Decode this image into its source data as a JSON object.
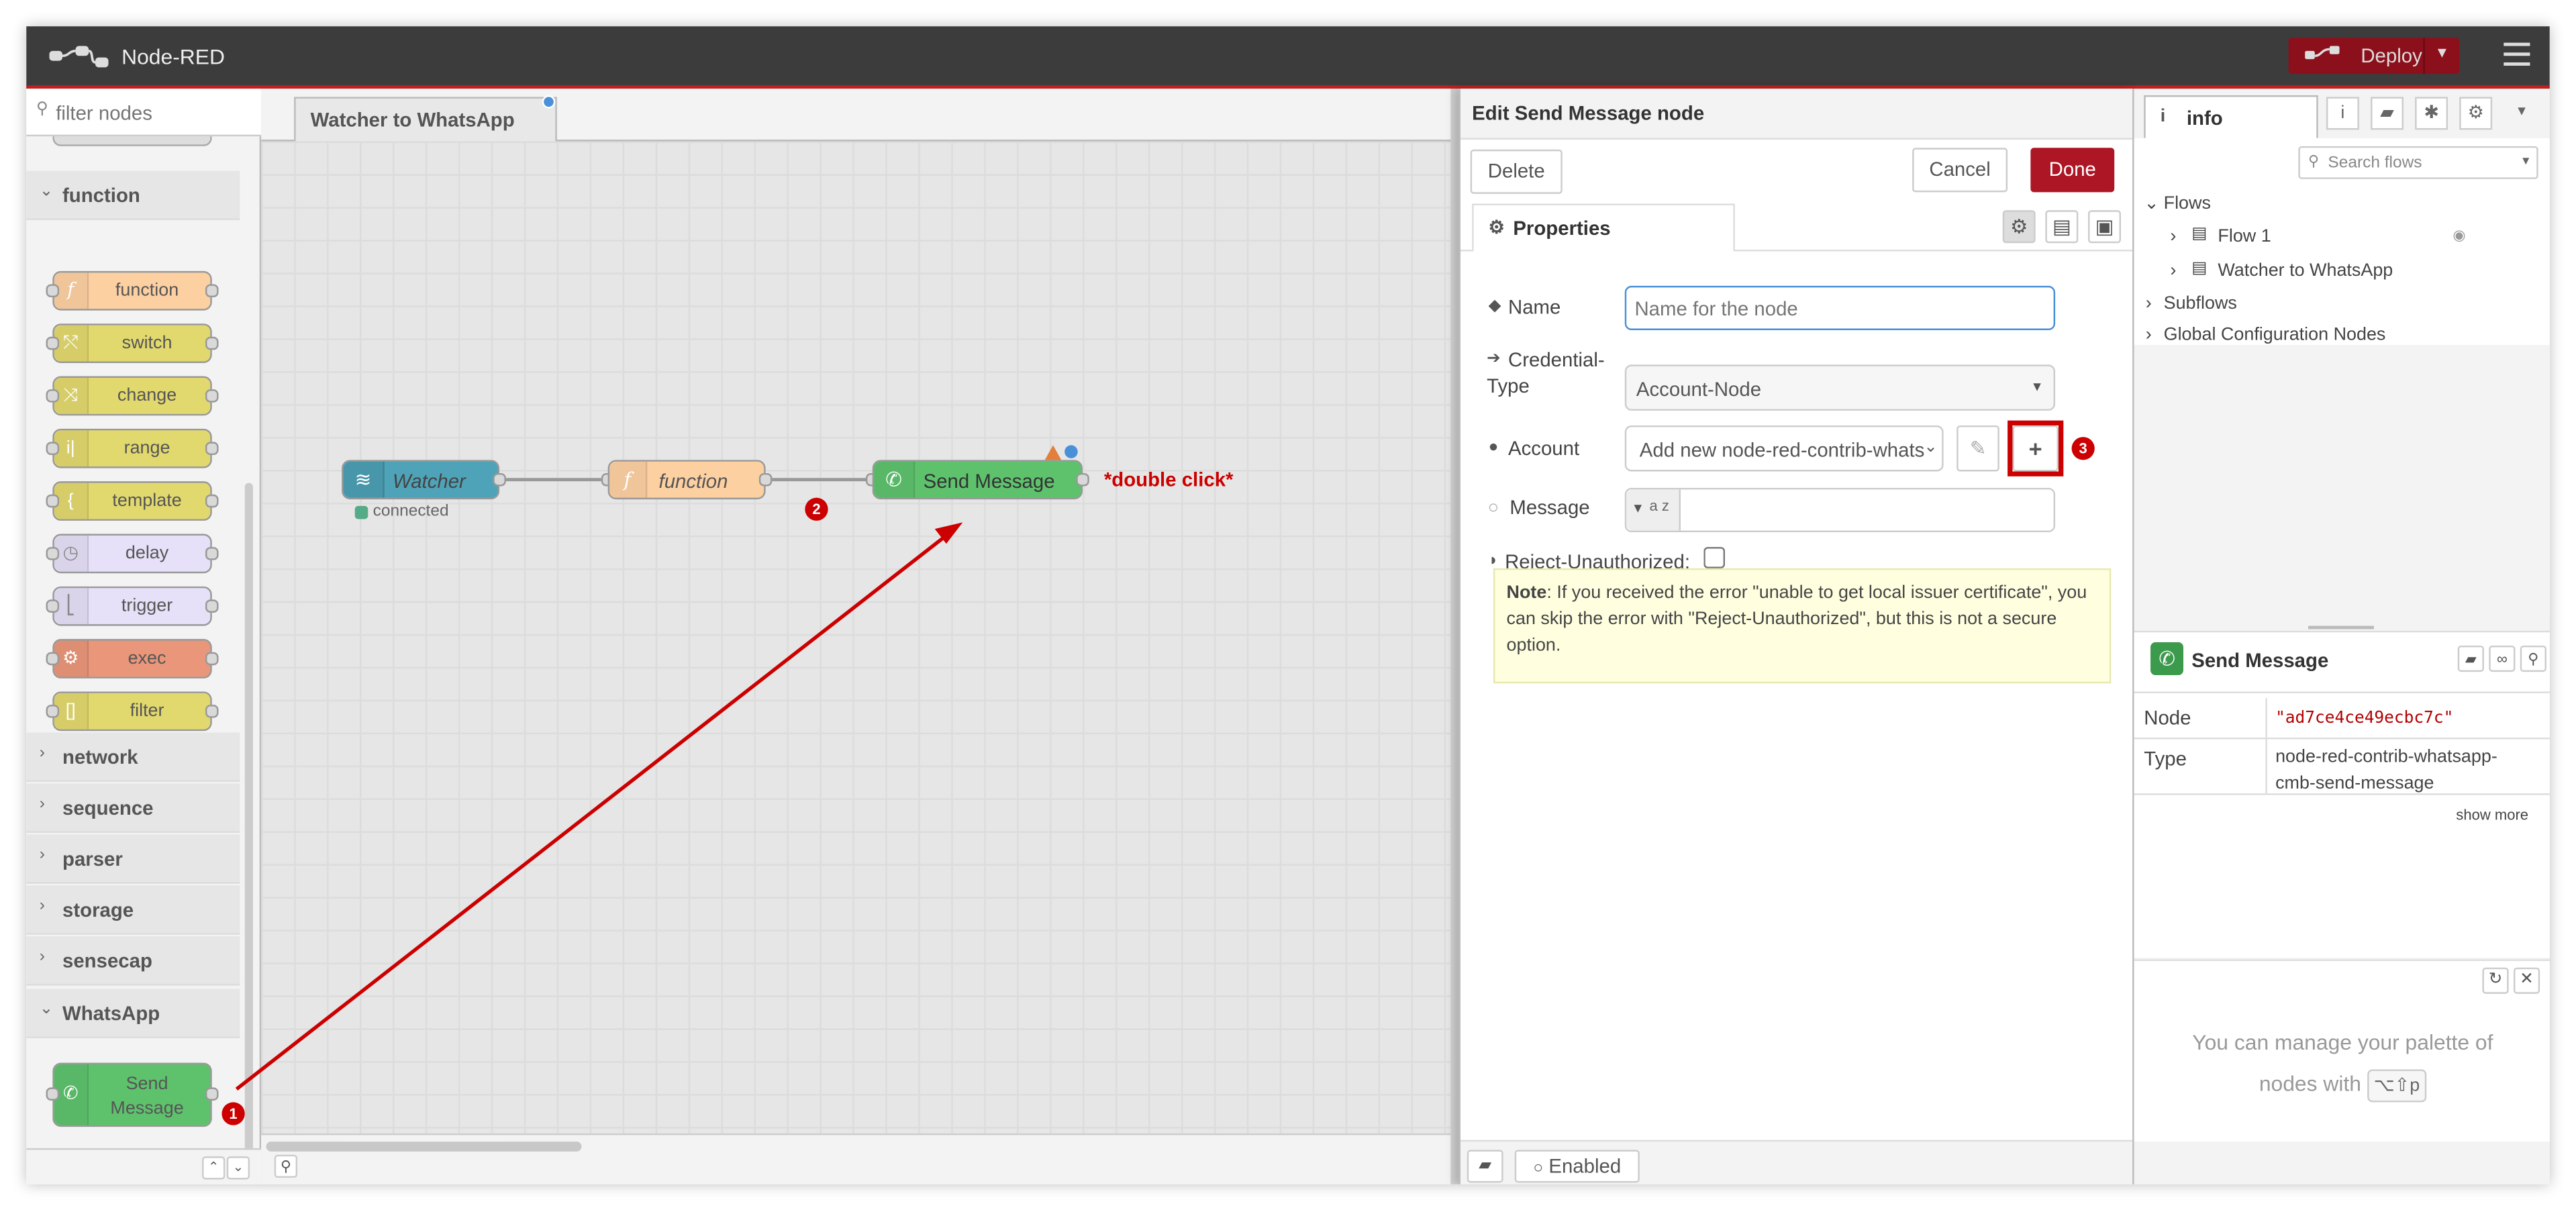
{
  "header": {
    "app_title": "Node-RED",
    "deploy_label": "Deploy"
  },
  "palette": {
    "filter_placeholder": "filter nodes",
    "function_category": "function",
    "function_nodes": [
      "function",
      "switch",
      "change",
      "range",
      "template",
      "delay",
      "trigger",
      "exec",
      "filter"
    ],
    "collapsed_categories": [
      "network",
      "sequence",
      "parser",
      "storage",
      "sensecap"
    ],
    "whatsapp_category": "WhatsApp",
    "whatsapp_node_line1": "Send",
    "whatsapp_node_line2": "Message"
  },
  "workspace": {
    "tab_label": "Watcher to WhatsApp",
    "nodes": {
      "watcher": "Watcher",
      "watcher_status": "connected",
      "function": "function",
      "send_message": "Send Message"
    },
    "annotation": "*double click*",
    "badges": [
      "1",
      "2",
      "3"
    ]
  },
  "editor": {
    "title": "Edit Send Message node",
    "delete_label": "Delete",
    "cancel_label": "Cancel",
    "done_label": "Done",
    "properties_tab": "Properties",
    "name_label": "Name",
    "name_placeholder": "Name for the node",
    "credential_label_line1": "Credential-",
    "credential_label_line2": "Type",
    "credential_value": "Account-Node",
    "account_label": "Account",
    "account_value": "Add new node-red-contrib-whats",
    "add_symbol": "+",
    "message_label": "Message",
    "message_type": "a z",
    "reject_label": "Reject-Unauthorized:",
    "note_bold": "Note",
    "note_text": ": If you received the error \"unable to get local issuer certificate\", you can skip the error with \"Reject-Unauthorized\", but this is not a secure option.",
    "enabled_label": "Enabled"
  },
  "sidebar": {
    "tab_label": "info",
    "search_placeholder": "Search flows",
    "tree": {
      "flows": "Flows",
      "flow1": "Flow 1",
      "flow2": "Watcher to WhatsApp",
      "subflows": "Subflows",
      "global": "Global Configuration Nodes"
    },
    "node_title": "Send Message",
    "node_key": "Node",
    "node_value": "\"ad7ce4ce49ecbc7c\"",
    "type_key": "Type",
    "type_value_line1": "node-red-contrib-whatsapp-",
    "type_value_line2": "cmb-send-message",
    "show_more": "show more",
    "tip_line1": "You can manage your palette of",
    "tip_line2": "nodes with",
    "tip_key": "⌥⇧p"
  },
  "colors": {
    "header_bg": "#3c3c3c",
    "accent_red": "#ad1625",
    "function_node": "#fdd0a2",
    "watcher_node": "#4fa3b8",
    "whatsapp_node": "#5ec26d",
    "annotation_red": "#cc0000"
  }
}
